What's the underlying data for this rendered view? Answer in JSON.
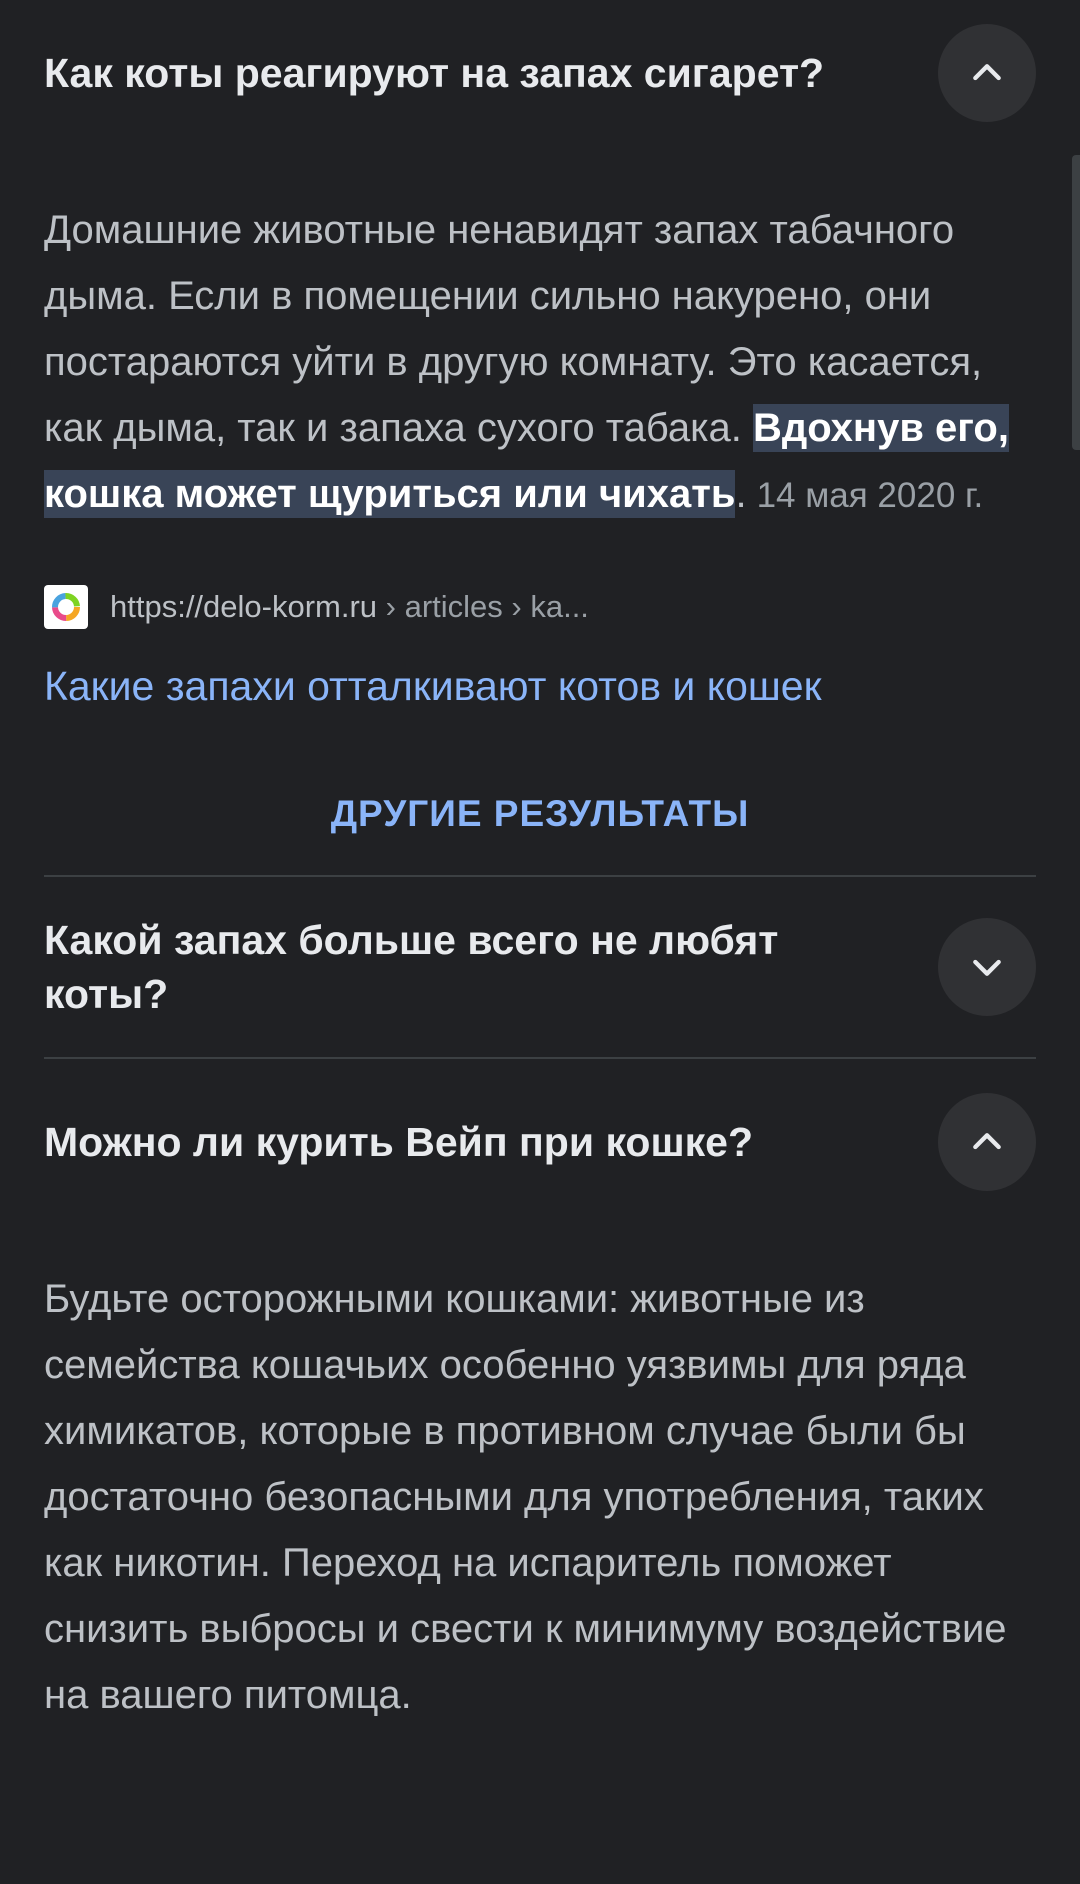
{
  "faq": [
    {
      "question": "Как коты реагируют на запах сигарет?",
      "expanded": true,
      "answer_text": "Домашние животные ненавидят запах табачного дыма. Если в помещении сильно накурено, они постараются уйти в другую комнату. Это касается, как дыма, так и запаха сухого табака. ",
      "answer_highlight": "Вдохнув его, кошка может щуриться или чихать",
      "answer_tail": ".",
      "date": "14 мая 2020 г.",
      "source_domain": "https://delo-korm.ru",
      "source_crumbs": " › articles › ka...",
      "result_title": "Какие запахи отталкивают котов и кошек"
    },
    {
      "question": "Какой запах больше всего не любят коты?",
      "expanded": false
    },
    {
      "question": "Можно ли курить Вейп при кошке?",
      "expanded": true,
      "answer_text": "Будьте осторожными кошками: животные из семейства кошачьих особенно уязвимы для ряда химикатов, которые в противном случае были бы достаточно безопасными для употребления, таких как никотин. Переход на испаритель поможет снизить выбросы и свести к минимуму воздействие на вашего питомца."
    }
  ],
  "more_results_label": "ДРУГИЕ РЕЗУЛЬТАТЫ",
  "colors": {
    "background": "#202124",
    "link": "#8ab4f8",
    "highlight": "#394457"
  }
}
